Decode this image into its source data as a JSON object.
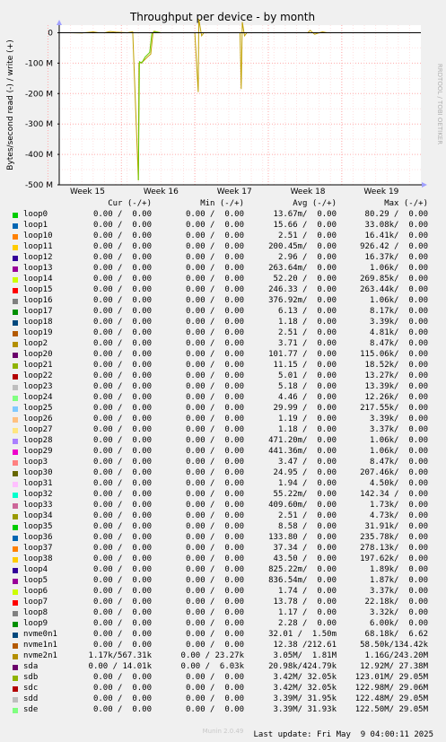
{
  "chart_data": {
    "type": "line",
    "title": "Throughput per device - by month",
    "ylabel": "Bytes/second read (-) / write (+)",
    "side_label": "RRDTOOL / TOBI OETIKER",
    "ylim": [
      -500000000,
      25000000
    ],
    "y_ticks": [
      {
        "value": 0,
        "label": "0"
      },
      {
        "value": -100000000,
        "label": "-100 M"
      },
      {
        "value": -200000000,
        "label": "-200 M"
      },
      {
        "value": -300000000,
        "label": "-300 M"
      },
      {
        "value": -400000000,
        "label": "-400 M"
      },
      {
        "value": -500000000,
        "label": "-500 M"
      }
    ],
    "x_ticks": [
      "Week 15",
      "Week 16",
      "Week 17",
      "Week 18",
      "Week 19"
    ],
    "x_range": [
      0,
      32
    ],
    "x_tick_positions": [
      2.5,
      9.0,
      15.5,
      22.0,
      28.5
    ],
    "series": [
      {
        "color": "#c0a000",
        "points": [
          [
            0,
            0
          ],
          [
            1,
            0
          ],
          [
            2,
            -1000000
          ],
          [
            3,
            3000000
          ],
          [
            3.5,
            0
          ],
          [
            4,
            0
          ],
          [
            4.5,
            4000000
          ],
          [
            5,
            2000000
          ],
          [
            6,
            0
          ],
          [
            6.5,
            3000000
          ],
          [
            7,
            -485000000
          ],
          [
            7.05,
            -100000000
          ],
          [
            7.4,
            -95000000
          ],
          [
            7.8,
            -80000000
          ],
          [
            8.1,
            -70000000
          ],
          [
            8.3,
            0
          ],
          [
            8.4,
            5000000
          ],
          [
            9,
            0
          ],
          [
            12,
            0
          ],
          [
            12.3,
            -195000000
          ],
          [
            12.35,
            45000000
          ],
          [
            12.6,
            -10000000
          ],
          [
            12.8,
            0
          ],
          [
            16,
            0
          ],
          [
            16.1,
            -185000000
          ],
          [
            16.2,
            35000000
          ],
          [
            16.4,
            -10000000
          ],
          [
            16.6,
            0
          ],
          [
            22,
            0
          ],
          [
            22.2,
            8000000
          ],
          [
            22.6,
            -5000000
          ],
          [
            23,
            0
          ],
          [
            23.3,
            3000000
          ],
          [
            23.7,
            0
          ],
          [
            32,
            0
          ]
        ]
      },
      {
        "color": "#66cc00",
        "points": [
          [
            7,
            -485000000
          ],
          [
            7.1,
            -95000000
          ],
          [
            7.3,
            -100000000
          ],
          [
            7.6,
            -80000000
          ],
          [
            8.0,
            -65000000
          ],
          [
            8.2,
            0
          ],
          [
            8.5,
            3000000
          ],
          [
            9,
            0
          ]
        ]
      },
      {
        "color": "#000000",
        "points": [
          [
            0,
            0
          ],
          [
            32,
            0
          ]
        ]
      }
    ],
    "columns": [
      "Cur (-/+)",
      "Min (-/+)",
      "Avg (-/+)",
      "Max (-/+)"
    ],
    "rows": [
      {
        "name": "loop0",
        "color": "#00cc00",
        "cur": "0.00 /  0.00",
        "min": "0.00 /  0.00",
        "avg": "13.67m/  0.00",
        "max": "80.29 /  0.00"
      },
      {
        "name": "loop1",
        "color": "#0066b3",
        "cur": "0.00 /  0.00",
        "min": "0.00 /  0.00",
        "avg": "15.66 /  0.00",
        "max": "33.08k/  0.00"
      },
      {
        "name": "loop10",
        "color": "#ff8000",
        "cur": "0.00 /  0.00",
        "min": "0.00 /  0.00",
        "avg": "2.51 /  0.00",
        "max": "16.41k/  0.00"
      },
      {
        "name": "loop11",
        "color": "#ffcc00",
        "cur": "0.00 /  0.00",
        "min": "0.00 /  0.00",
        "avg": "200.45m/  0.00",
        "max": "926.42 /  0.00"
      },
      {
        "name": "loop12",
        "color": "#330099",
        "cur": "0.00 /  0.00",
        "min": "0.00 /  0.00",
        "avg": "2.96 /  0.00",
        "max": "16.37k/  0.00"
      },
      {
        "name": "loop13",
        "color": "#990099",
        "cur": "0.00 /  0.00",
        "min": "0.00 /  0.00",
        "avg": "263.64m/  0.00",
        "max": "1.06k/  0.00"
      },
      {
        "name": "loop14",
        "color": "#ccff00",
        "cur": "0.00 /  0.00",
        "min": "0.00 /  0.00",
        "avg": "52.20 /  0.00",
        "max": "269.85k/  0.00"
      },
      {
        "name": "loop15",
        "color": "#ff0000",
        "cur": "0.00 /  0.00",
        "min": "0.00 /  0.00",
        "avg": "246.33 /  0.00",
        "max": "263.44k/  0.00"
      },
      {
        "name": "loop16",
        "color": "#808080",
        "cur": "0.00 /  0.00",
        "min": "0.00 /  0.00",
        "avg": "376.92m/  0.00",
        "max": "1.06k/  0.00"
      },
      {
        "name": "loop17",
        "color": "#008f00",
        "cur": "0.00 /  0.00",
        "min": "0.00 /  0.00",
        "avg": "6.13 /  0.00",
        "max": "8.17k/  0.00"
      },
      {
        "name": "loop18",
        "color": "#00487d",
        "cur": "0.00 /  0.00",
        "min": "0.00 /  0.00",
        "avg": "1.18 /  0.00",
        "max": "3.39k/  0.00"
      },
      {
        "name": "loop19",
        "color": "#b35a00",
        "cur": "0.00 /  0.00",
        "min": "0.00 /  0.00",
        "avg": "2.51 /  0.00",
        "max": "4.81k/  0.00"
      },
      {
        "name": "loop2",
        "color": "#b38f00",
        "cur": "0.00 /  0.00",
        "min": "0.00 /  0.00",
        "avg": "3.71 /  0.00",
        "max": "8.47k/  0.00"
      },
      {
        "name": "loop20",
        "color": "#6b006b",
        "cur": "0.00 /  0.00",
        "min": "0.00 /  0.00",
        "avg": "101.77 /  0.00",
        "max": "115.06k/  0.00"
      },
      {
        "name": "loop21",
        "color": "#8fb300",
        "cur": "0.00 /  0.00",
        "min": "0.00 /  0.00",
        "avg": "11.15 /  0.00",
        "max": "18.52k/  0.00"
      },
      {
        "name": "loop22",
        "color": "#b30000",
        "cur": "0.00 /  0.00",
        "min": "0.00 /  0.00",
        "avg": "5.01 /  0.00",
        "max": "13.27k/  0.00"
      },
      {
        "name": "loop23",
        "color": "#bebebe",
        "cur": "0.00 /  0.00",
        "min": "0.00 /  0.00",
        "avg": "5.18 /  0.00",
        "max": "13.39k/  0.00"
      },
      {
        "name": "loop24",
        "color": "#80ff80",
        "cur": "0.00 /  0.00",
        "min": "0.00 /  0.00",
        "avg": "4.46 /  0.00",
        "max": "12.26k/  0.00"
      },
      {
        "name": "loop25",
        "color": "#80c9ff",
        "cur": "0.00 /  0.00",
        "min": "0.00 /  0.00",
        "avg": "29.99 /  0.00",
        "max": "217.55k/  0.00"
      },
      {
        "name": "loop26",
        "color": "#ffc080",
        "cur": "0.00 /  0.00",
        "min": "0.00 /  0.00",
        "avg": "1.19 /  0.00",
        "max": "3.39k/  0.00"
      },
      {
        "name": "loop27",
        "color": "#ffe680",
        "cur": "0.00 /  0.00",
        "min": "0.00 /  0.00",
        "avg": "1.18 /  0.00",
        "max": "3.37k/  0.00"
      },
      {
        "name": "loop28",
        "color": "#aa80ff",
        "cur": "0.00 /  0.00",
        "min": "0.00 /  0.00",
        "avg": "471.20m/  0.00",
        "max": "1.06k/  0.00"
      },
      {
        "name": "loop29",
        "color": "#ee00cc",
        "cur": "0.00 /  0.00",
        "min": "0.00 /  0.00",
        "avg": "441.36m/  0.00",
        "max": "1.06k/  0.00"
      },
      {
        "name": "loop3",
        "color": "#ff8080",
        "cur": "0.00 /  0.00",
        "min": "0.00 /  0.00",
        "avg": "3.47 /  0.00",
        "max": "8.47k/  0.00"
      },
      {
        "name": "loop30",
        "color": "#666600",
        "cur": "0.00 /  0.00",
        "min": "0.00 /  0.00",
        "avg": "24.95 /  0.00",
        "max": "207.46k/  0.00"
      },
      {
        "name": "loop31",
        "color": "#ffbfff",
        "cur": "0.00 /  0.00",
        "min": "0.00 /  0.00",
        "avg": "1.94 /  0.00",
        "max": "4.50k/  0.00"
      },
      {
        "name": "loop32",
        "color": "#00ffcc",
        "cur": "0.00 /  0.00",
        "min": "0.00 /  0.00",
        "avg": "55.22m/  0.00",
        "max": "142.34 /  0.00"
      },
      {
        "name": "loop33",
        "color": "#cc6699",
        "cur": "0.00 /  0.00",
        "min": "0.00 /  0.00",
        "avg": "409.60m/  0.00",
        "max": "1.73k/  0.00"
      },
      {
        "name": "loop34",
        "color": "#999900",
        "cur": "0.00 /  0.00",
        "min": "0.00 /  0.00",
        "avg": "2.51 /  0.00",
        "max": "4.73k/  0.00"
      },
      {
        "name": "loop35",
        "color": "#00cc00",
        "cur": "0.00 /  0.00",
        "min": "0.00 /  0.00",
        "avg": "8.58 /  0.00",
        "max": "31.91k/  0.00"
      },
      {
        "name": "loop36",
        "color": "#0066b3",
        "cur": "0.00 /  0.00",
        "min": "0.00 /  0.00",
        "avg": "133.80 /  0.00",
        "max": "235.78k/  0.00"
      },
      {
        "name": "loop37",
        "color": "#ff8000",
        "cur": "0.00 /  0.00",
        "min": "0.00 /  0.00",
        "avg": "37.34 /  0.00",
        "max": "278.13k/  0.00"
      },
      {
        "name": "loop38",
        "color": "#ffcc00",
        "cur": "0.00 /  0.00",
        "min": "0.00 /  0.00",
        "avg": "43.50 /  0.00",
        "max": "197.62k/  0.00"
      },
      {
        "name": "loop4",
        "color": "#330099",
        "cur": "0.00 /  0.00",
        "min": "0.00 /  0.00",
        "avg": "825.22m/  0.00",
        "max": "1.89k/  0.00"
      },
      {
        "name": "loop5",
        "color": "#990099",
        "cur": "0.00 /  0.00",
        "min": "0.00 /  0.00",
        "avg": "836.54m/  0.00",
        "max": "1.87k/  0.00"
      },
      {
        "name": "loop6",
        "color": "#ccff00",
        "cur": "0.00 /  0.00",
        "min": "0.00 /  0.00",
        "avg": "1.74 /  0.00",
        "max": "3.37k/  0.00"
      },
      {
        "name": "loop7",
        "color": "#ff0000",
        "cur": "0.00 /  0.00",
        "min": "0.00 /  0.00",
        "avg": "13.78 /  0.00",
        "max": "22.18k/  0.00"
      },
      {
        "name": "loop8",
        "color": "#808080",
        "cur": "0.00 /  0.00",
        "min": "0.00 /  0.00",
        "avg": "1.17 /  0.00",
        "max": "3.32k/  0.00"
      },
      {
        "name": "loop9",
        "color": "#008f00",
        "cur": "0.00 /  0.00",
        "min": "0.00 /  0.00",
        "avg": "2.28 /  0.00",
        "max": "6.00k/  0.00"
      },
      {
        "name": "nvme0n1",
        "color": "#00487d",
        "cur": "0.00 /  0.00",
        "min": "0.00 /  0.00",
        "avg": "32.01 /  1.50m",
        "max": "68.18k/  6.62"
      },
      {
        "name": "nvme1n1",
        "color": "#b35a00",
        "cur": "0.00 /  0.00",
        "min": "0.00 /  0.00",
        "avg": "12.38 /212.61",
        "max": "58.50k/134.42k"
      },
      {
        "name": "nvme2n1",
        "color": "#b38f00",
        "cur": "1.17k/567.31k",
        "min": "0.00 / 23.27k",
        "avg": "3.05M/  1.81M",
        "max": "1.16G/243.20M"
      },
      {
        "name": "sda",
        "color": "#6b006b",
        "cur": "0.00 / 14.01k",
        "min": "0.00 /  6.03k",
        "avg": "20.98k/424.79k",
        "max": "12.92M/ 27.38M"
      },
      {
        "name": "sdb",
        "color": "#8fb300",
        "cur": "0.00 /  0.00",
        "min": "0.00 /  0.00",
        "avg": "3.42M/ 32.05k",
        "max": "123.01M/ 29.05M"
      },
      {
        "name": "sdc",
        "color": "#b30000",
        "cur": "0.00 /  0.00",
        "min": "0.00 /  0.00",
        "avg": "3.42M/ 32.05k",
        "max": "122.98M/ 29.06M"
      },
      {
        "name": "sdd",
        "color": "#bebebe",
        "cur": "0.00 /  0.00",
        "min": "0.00 /  0.00",
        "avg": "3.39M/ 31.95k",
        "max": "122.48M/ 29.05M"
      },
      {
        "name": "sde",
        "color": "#80ff80",
        "cur": "0.00 /  0.00",
        "min": "0.00 /  0.00",
        "avg": "3.39M/ 31.93k",
        "max": "122.50M/ 29.05M"
      }
    ],
    "last_update": "Last update: Fri May  9 04:00:11 2025",
    "version": "Munin 2.0.49"
  }
}
